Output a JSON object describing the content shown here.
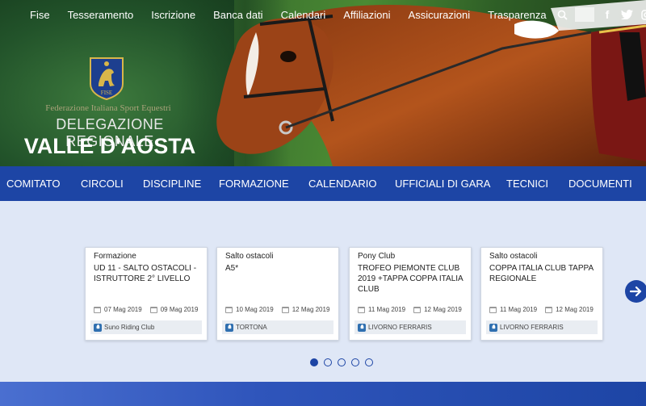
{
  "topnav": {
    "links": [
      "Fise",
      "Tesseramento",
      "Iscrizione",
      "Banca dati",
      "Calendari",
      "Affiliazioni",
      "Assicurazioni",
      "Trasparenza"
    ],
    "icons": [
      "search-icon",
      "facebook-icon",
      "twitter-icon",
      "instagram-icon"
    ]
  },
  "brand": {
    "logo_text": "FISE",
    "federation": "Federazione Italiana Sport Equestri",
    "delegation": "DELEGAZIONE REGIONALE",
    "region": "VALLE D'AOSTA"
  },
  "mainnav": [
    "COMITATO",
    "CIRCOLI",
    "DISCIPLINE",
    "FORMAZIONE",
    "CALENDARIO",
    "UFFICIALI DI GARA",
    "TECNICI",
    "DOCUMENTI"
  ],
  "events": [
    {
      "category": "Formazione",
      "title": "UD 11 - SALTO OSTACOLI - ISTRUTTORE 2° LIVELLO",
      "start": "07 Mag 2019",
      "end": "09 Mag 2019",
      "place": "Suno Riding Club"
    },
    {
      "category": "Salto ostacoli",
      "title": "A5*",
      "start": "10 Mag 2019",
      "end": "12 Mag 2019",
      "place": "TORTONA"
    },
    {
      "category": "Pony Club",
      "title": "TROFEO PIEMONTE CLUB 2019 +TAPPA COPPA ITALIA CLUB",
      "start": "11 Mag 2019",
      "end": "12 Mag 2019",
      "place": "LIVORNO FERRARIS"
    },
    {
      "category": "Salto ostacoli",
      "title": "COPPA ITALIA CLUB TAPPA REGIONALE",
      "start": "11 Mag 2019",
      "end": "12 Mag 2019",
      "place": "LIVORNO FERRARIS"
    }
  ],
  "carousel": {
    "pages": 5,
    "active_page": 1
  },
  "colors": {
    "nav_blue": "#1d45a5",
    "page_bg": "#dfe7f6"
  }
}
